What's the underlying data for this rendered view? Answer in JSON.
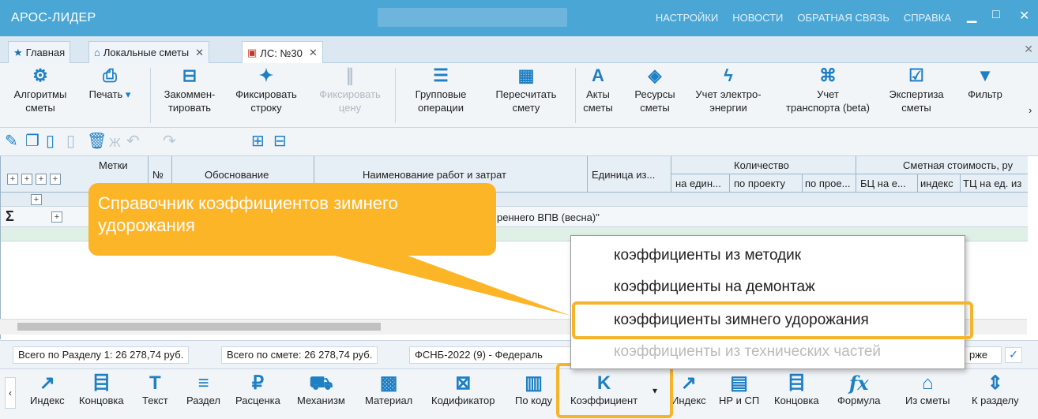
{
  "window": {
    "app_name": "АРОС-ЛИДЕР",
    "menu": [
      "НАСТРОЙКИ",
      "НОВОСТИ",
      "ОБРАТНАЯ СВЯЗЬ",
      "СПРАВКА"
    ],
    "minimize": "▁",
    "maximize": "□",
    "close": "✕"
  },
  "tabs": [
    {
      "label": "Главная",
      "icon": "star-icon"
    },
    {
      "label": "Локальные сметы",
      "icon": "home-icon"
    },
    {
      "label": "ЛС: №30",
      "icon": "document-icon"
    }
  ],
  "tab_close": "✕",
  "ribbon": {
    "algorithms": "Алгоритмы\nсметы",
    "print": "Печать",
    "comment": "Закоммен-\nтировать",
    "fix_row": "Фиксировать\nстроку",
    "fix_price": "Фиксировать\nцену",
    "group_ops": "Групповые\nоперации",
    "recalc": "Пересчитать\nсмету",
    "acts": "Акты\nсметы",
    "resources": "Ресурсы\nсметы",
    "electricity": "Учет электро-\nэнергии",
    "transport": "Учет\nтранспорта (beta)",
    "expertise": "Экспертиза\nсметы",
    "filter": "Фильтр"
  },
  "grid": {
    "col_marks": "Метки",
    "col_no": "№",
    "col_basis": "Обоснование",
    "col_name": "Наименование работ и затрат",
    "col_unit": "Единица из...",
    "col_quantity": "Количество",
    "col_qty_per_unit": "на един...",
    "col_qty_project": "по проекту",
    "col_qty_proe": "по прое...",
    "col_cost": "Сметная стоимость, ру",
    "col_bc": "БЦ на е...",
    "col_index": "индекс",
    "col_tc": "ТЦ на ед. из",
    "row_text": "реннего ВПВ (весна)\""
  },
  "status": {
    "section_total": "Всего по Разделу 1: 26 278,74 руб.",
    "estimate_total": "Всего по смете: 26 278,74 руб.",
    "base": "ФСНБ-2022 (9) - Федераль",
    "right_select": "рже"
  },
  "bottom": {
    "index": "Индекс",
    "ending": "Концовка",
    "text": "Текст",
    "section": "Раздел",
    "rate": "Расценка",
    "mechanism": "Механизм",
    "material": "Материал",
    "codifier": "Кодификатор",
    "by_code": "По коду",
    "coefficient": "Коэффициент",
    "index2": "Индекс",
    "np_sp": "НР и СП",
    "ending2": "Концовка",
    "formula": "Формула",
    "from_estimate": "Из сметы",
    "to_section": "К разделу"
  },
  "callout": "Справочник коэффициентов зимнего удорожания",
  "popup_items": [
    "коэффициенты из методик",
    "коэффициенты на демонтаж",
    "коэффициенты зимнего удорожания",
    "коэффициенты из технических частей"
  ],
  "colors": {
    "accent": "#4aa6d5",
    "highlight": "#f6b42c",
    "callout": "#fdb528"
  }
}
